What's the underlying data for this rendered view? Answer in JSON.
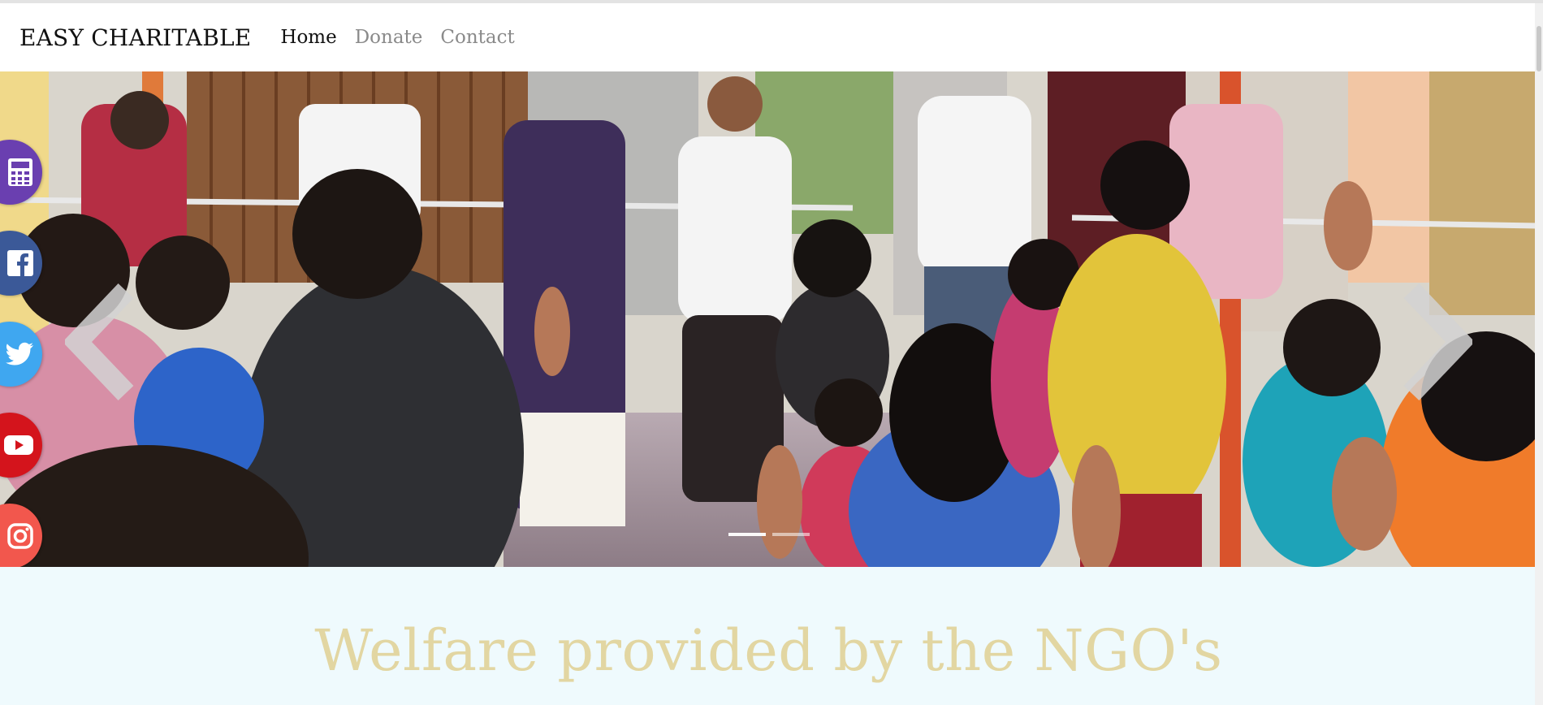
{
  "navbar": {
    "brand": "EASY CHARITABLE",
    "links": [
      {
        "label": "Home",
        "active": true
      },
      {
        "label": "Donate",
        "active": false
      },
      {
        "label": "Contact",
        "active": false
      }
    ]
  },
  "carousel": {
    "slide_count": 2,
    "active_slide": 1,
    "controls": {
      "prev_icon": "chevron-left-icon",
      "next_icon": "chevron-right-icon"
    }
  },
  "social": [
    {
      "name": "calculator",
      "icon": "calculator-icon",
      "color": "#6a3fb0"
    },
    {
      "name": "facebook",
      "icon": "facebook-icon",
      "color": "#3b5998"
    },
    {
      "name": "twitter",
      "icon": "twitter-icon",
      "color": "#3fa7f0"
    },
    {
      "name": "youtube",
      "icon": "youtube-icon",
      "color": "#d4141c"
    },
    {
      "name": "instagram",
      "icon": "instagram-icon",
      "color": "#f2574d"
    }
  ],
  "welfare": {
    "title": "Welfare provided by the NGO's",
    "title_color": "#e2d6a2",
    "background": "#effafd"
  }
}
